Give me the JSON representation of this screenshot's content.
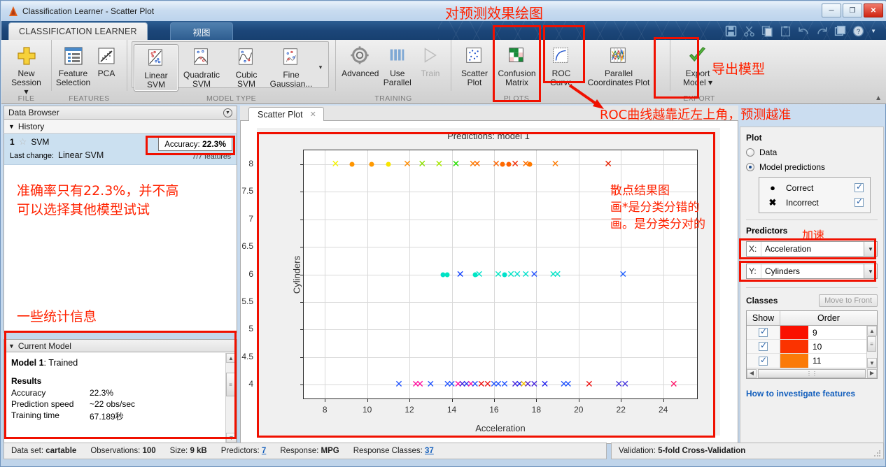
{
  "window": {
    "title": "Classification Learner - Scatter Plot",
    "minimize": "─",
    "maximize": "❐",
    "close": "✕"
  },
  "ribbon": {
    "tabs": [
      {
        "label": "CLASSIFICATION LEARNER",
        "active": true
      },
      {
        "label": "视图",
        "active": false
      }
    ],
    "quick_access": [
      "save-icon",
      "cut-icon",
      "copy-icon",
      "paste-icon",
      "undo-icon",
      "redo-icon",
      "layout-icon",
      "help-icon",
      "chevron-down-icon"
    ],
    "groups": [
      {
        "name": "FILE",
        "buttons": [
          {
            "label": "New\nSession ▾",
            "icon": "plus-icon"
          }
        ]
      },
      {
        "name": "FEATURES",
        "buttons": [
          {
            "label": "Feature\nSelection",
            "icon": "list-icon"
          },
          {
            "label": "PCA",
            "icon": "pca-icon"
          }
        ]
      },
      {
        "name": "MODEL TYPE",
        "buttons": [
          {
            "label": "Linear SVM",
            "icon": "linear-svm-icon",
            "selected": true
          },
          {
            "label": "Quadratic\nSVM",
            "icon": "quadratic-svm-icon"
          },
          {
            "label": "Cubic SVM",
            "icon": "cubic-svm-icon"
          },
          {
            "label": "Fine\nGaussian...",
            "icon": "fine-gaussian-icon"
          }
        ],
        "more": "▾"
      },
      {
        "name": "TRAINING",
        "buttons": [
          {
            "label": "Advanced",
            "icon": "gear-icon"
          },
          {
            "label": "Use\nParallel",
            "icon": "parallel-bars-icon"
          },
          {
            "label": "Train",
            "icon": "play-icon",
            "disabled": true
          }
        ]
      },
      {
        "name": "PLOTS",
        "buttons": [
          {
            "label": "Scatter\nPlot",
            "icon": "scatter-plot-icon"
          },
          {
            "label": "Confusion\nMatrix",
            "icon": "confusion-matrix-icon"
          },
          {
            "label": "ROC Curve",
            "icon": "roc-curve-icon"
          },
          {
            "label": "Parallel\nCoordinates Plot",
            "icon": "parallel-coordinates-icon"
          }
        ]
      },
      {
        "name": "EXPORT",
        "buttons": [
          {
            "label": "Export\nModel ▾",
            "icon": "green-check-icon"
          }
        ]
      }
    ],
    "collapse": "▲"
  },
  "left_panel": {
    "header": "Data Browser",
    "history_label": "History",
    "history_items": [
      {
        "num": "1",
        "star": "☆",
        "name": "SVM",
        "accuracy_label": "Accuracy:",
        "accuracy_value": "22.3%",
        "last_change_label": "Last change:",
        "last_change_value": "Linear SVM",
        "features": "7/7 features"
      }
    ],
    "current_model": {
      "header": "Current Model",
      "model_title_bold": "Model 1",
      "model_title_rest": ": Trained",
      "results_label": "Results",
      "rows": [
        {
          "key": "Accuracy",
          "value": "22.3%"
        },
        {
          "key": "Prediction speed",
          "value": "~22 obs/sec"
        },
        {
          "key": "Training time",
          "value": "67.189秒"
        }
      ]
    }
  },
  "document": {
    "tab_label": "Scatter Plot",
    "tab_close": "✕"
  },
  "right_panel": {
    "plot_label": "Plot",
    "radios": [
      {
        "label": "Data",
        "selected": false
      },
      {
        "label": "Model predictions",
        "selected": true
      }
    ],
    "legend": [
      {
        "symbol": "●",
        "name": "Correct",
        "checked": true
      },
      {
        "symbol": "✖",
        "name": "Incorrect",
        "checked": true
      }
    ],
    "predictors_label": "Predictors",
    "x_label": "X:",
    "x_value": "Acceleration",
    "y_label": "Y:",
    "y_value": "Cylinders",
    "dropdown_arrow": "▼",
    "classes_label": "Classes",
    "move_to_front": "Move to Front",
    "table_headers": [
      "Show",
      "Order"
    ],
    "class_rows": [
      {
        "checked": true,
        "color": "#fa1000",
        "order": "9"
      },
      {
        "checked": true,
        "color": "#fb3300",
        "order": "10"
      },
      {
        "checked": true,
        "color": "#fb7a08",
        "order": "11"
      }
    ],
    "link": "How to investigate features"
  },
  "statusbar": {
    "left_items": [
      {
        "key": "Data set:",
        "value": "cartable",
        "link": false
      },
      {
        "key": "Observations:",
        "value": "100",
        "link": false
      },
      {
        "key": "Size:",
        "value": "9 kB",
        "link": false
      },
      {
        "key": "Predictors:",
        "value": "7",
        "link": true
      },
      {
        "key": "Response:",
        "value": "MPG",
        "link": false
      },
      {
        "key": "Response Classes:",
        "value": "37",
        "link": true
      }
    ],
    "right_items": [
      {
        "key": "Validation:",
        "value": "5-fold Cross-Validation",
        "link": false
      }
    ]
  },
  "annotations": [
    {
      "id": "ann-top",
      "text": "对预测效果绘图"
    },
    {
      "id": "ann-export",
      "text": "导出模型"
    },
    {
      "id": "ann-roc",
      "text": "ROC曲线越靠近左上角，预测越准"
    },
    {
      "id": "ann-accuracy",
      "text": "准确率只有22.3%，并不高\n可以选择其他模型试试"
    },
    {
      "id": "ann-stats",
      "text": "一些统计信息"
    },
    {
      "id": "ann-scatter",
      "text": "散点结果图\n画*是分类分错的\n画。是分类分对的"
    },
    {
      "id": "ann-predictors",
      "text": "加速"
    }
  ],
  "chart_data": {
    "type": "scatter",
    "title": "Predictions: model 1",
    "xlabel": "Acceleration",
    "ylabel": "Cylinders",
    "xlim": [
      7.0,
      25.6
    ],
    "ylim": [
      3.75,
      8.25
    ],
    "xticks": [
      8,
      10,
      12,
      14,
      16,
      18,
      20,
      22,
      24
    ],
    "yticks": [
      4,
      4.5,
      5,
      5.5,
      6,
      6.5,
      7,
      7.5,
      8
    ],
    "grid": true,
    "legend": [
      "Correct",
      "Incorrect"
    ],
    "marker_semantics": {
      "dot": "Correct",
      "x": "Incorrect"
    },
    "points": [
      {
        "x": 8.5,
        "y": 8,
        "m": "x",
        "c": "#f5f500"
      },
      {
        "x": 9.3,
        "y": 8,
        "m": "dot",
        "c": "#ff9500"
      },
      {
        "x": 10.2,
        "y": 8,
        "m": "dot",
        "c": "#ff9a00"
      },
      {
        "x": 11.0,
        "y": 8,
        "m": "dot",
        "c": "#f8e500"
      },
      {
        "x": 11.9,
        "y": 8,
        "m": "x",
        "c": "#ff8c00"
      },
      {
        "x": 12.6,
        "y": 8,
        "m": "x",
        "c": "#8de000"
      },
      {
        "x": 13.4,
        "y": 8,
        "m": "x",
        "c": "#a8e800"
      },
      {
        "x": 14.2,
        "y": 8,
        "m": "x",
        "c": "#27e000"
      },
      {
        "x": 15.0,
        "y": 8,
        "m": "x",
        "c": "#ff7b00"
      },
      {
        "x": 15.2,
        "y": 8,
        "m": "x",
        "c": "#ff7000"
      },
      {
        "x": 16.1,
        "y": 8,
        "m": "x",
        "c": "#ff6600"
      },
      {
        "x": 16.4,
        "y": 8,
        "m": "dot",
        "c": "#ff6a00"
      },
      {
        "x": 16.7,
        "y": 8,
        "m": "dot",
        "c": "#ff5f00"
      },
      {
        "x": 17.0,
        "y": 8,
        "m": "x",
        "c": "#f22a00"
      },
      {
        "x": 17.5,
        "y": 8,
        "m": "x",
        "c": "#ff6f00"
      },
      {
        "x": 17.7,
        "y": 8,
        "m": "dot",
        "c": "#ff7a00"
      },
      {
        "x": 18.9,
        "y": 8,
        "m": "x",
        "c": "#ff7b00"
      },
      {
        "x": 21.4,
        "y": 8,
        "m": "x",
        "c": "#e82000"
      },
      {
        "x": 13.6,
        "y": 6,
        "m": "dot",
        "c": "#00e0c8"
      },
      {
        "x": 13.8,
        "y": 6,
        "m": "dot",
        "c": "#00e5c0"
      },
      {
        "x": 14.4,
        "y": 6,
        "m": "x",
        "c": "#1040ff"
      },
      {
        "x": 15.1,
        "y": 6,
        "m": "dot",
        "c": "#00e6c4"
      },
      {
        "x": 15.3,
        "y": 6,
        "m": "x",
        "c": "#00e2cc"
      },
      {
        "x": 16.2,
        "y": 6,
        "m": "x",
        "c": "#00e6c4"
      },
      {
        "x": 16.5,
        "y": 6,
        "m": "dot",
        "c": "#00e2cc"
      },
      {
        "x": 16.8,
        "y": 6,
        "m": "x",
        "c": "#00e6c4"
      },
      {
        "x": 17.1,
        "y": 6,
        "m": "x",
        "c": "#00dfd0"
      },
      {
        "x": 17.5,
        "y": 6,
        "m": "x",
        "c": "#00e2cc"
      },
      {
        "x": 17.9,
        "y": 6,
        "m": "x",
        "c": "#2050ff"
      },
      {
        "x": 18.8,
        "y": 6,
        "m": "x",
        "c": "#00e6c4"
      },
      {
        "x": 19.0,
        "y": 6,
        "m": "x",
        "c": "#00e2cc"
      },
      {
        "x": 22.1,
        "y": 6,
        "m": "x",
        "c": "#2060ff"
      },
      {
        "x": 11.5,
        "y": 4,
        "m": "x",
        "c": "#2255ff"
      },
      {
        "x": 12.3,
        "y": 4,
        "m": "x",
        "c": "#ff11a0"
      },
      {
        "x": 12.5,
        "y": 4,
        "m": "x",
        "c": "#ff11a0"
      },
      {
        "x": 13.0,
        "y": 4,
        "m": "x",
        "c": "#2255ff"
      },
      {
        "x": 13.8,
        "y": 4,
        "m": "x",
        "c": "#2255ff"
      },
      {
        "x": 14.0,
        "y": 4,
        "m": "x",
        "c": "#2255ff"
      },
      {
        "x": 14.3,
        "y": 4,
        "m": "x",
        "c": "#ff11a0"
      },
      {
        "x": 14.5,
        "y": 4,
        "m": "x",
        "c": "#4422e0"
      },
      {
        "x": 14.7,
        "y": 4,
        "m": "x",
        "c": "#2233ee"
      },
      {
        "x": 14.9,
        "y": 4,
        "m": "x",
        "c": "#ff11a0"
      },
      {
        "x": 15.1,
        "y": 4,
        "m": "x",
        "c": "#2255ff"
      },
      {
        "x": 15.4,
        "y": 4,
        "m": "x",
        "c": "#ee1111"
      },
      {
        "x": 15.7,
        "y": 4,
        "m": "x",
        "c": "#ee1111"
      },
      {
        "x": 16.0,
        "y": 4,
        "m": "x",
        "c": "#2255ff"
      },
      {
        "x": 16.2,
        "y": 4,
        "m": "x",
        "c": "#2255ff"
      },
      {
        "x": 16.5,
        "y": 4,
        "m": "x",
        "c": "#2255ff"
      },
      {
        "x": 17.0,
        "y": 4,
        "m": "x",
        "c": "#4422dd"
      },
      {
        "x": 17.2,
        "y": 4,
        "m": "x",
        "c": "#2222ee"
      },
      {
        "x": 17.4,
        "y": 4,
        "m": "x",
        "c": "#f5c400"
      },
      {
        "x": 17.6,
        "y": 4,
        "m": "x",
        "c": "#5522cc"
      },
      {
        "x": 17.9,
        "y": 4,
        "m": "x",
        "c": "#4422dd"
      },
      {
        "x": 18.4,
        "y": 4,
        "m": "x",
        "c": "#2222ee"
      },
      {
        "x": 19.3,
        "y": 4,
        "m": "x",
        "c": "#2255ff"
      },
      {
        "x": 19.5,
        "y": 4,
        "m": "x",
        "c": "#2255ff"
      },
      {
        "x": 20.5,
        "y": 4,
        "m": "x",
        "c": "#ee1111"
      },
      {
        "x": 21.9,
        "y": 4,
        "m": "x",
        "c": "#4433dd"
      },
      {
        "x": 22.2,
        "y": 4,
        "m": "x",
        "c": "#4433dd"
      },
      {
        "x": 24.5,
        "y": 4,
        "m": "x",
        "c": "#ff1166"
      }
    ]
  }
}
